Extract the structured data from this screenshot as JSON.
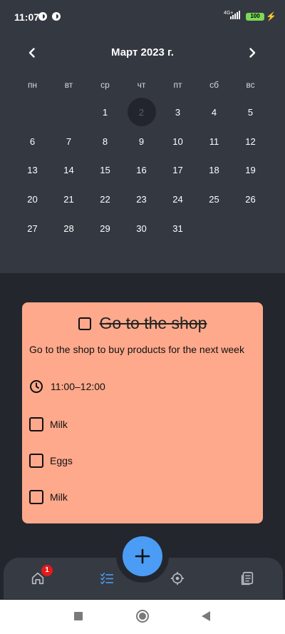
{
  "status_bar": {
    "time": "11:07",
    "network": "4G+",
    "battery": "100"
  },
  "calendar": {
    "month_title": "Март 2023 г.",
    "weekdays": [
      "пн",
      "вт",
      "ср",
      "чт",
      "пт",
      "сб",
      "вс"
    ],
    "leading_blanks": 2,
    "days": [
      "1",
      "2",
      "3",
      "4",
      "5",
      "6",
      "7",
      "8",
      "9",
      "10",
      "11",
      "12",
      "13",
      "14",
      "15",
      "16",
      "17",
      "18",
      "19",
      "20",
      "21",
      "22",
      "23",
      "24",
      "25",
      "26",
      "27",
      "28",
      "29",
      "30",
      "31"
    ],
    "selected_day": "2"
  },
  "task": {
    "title": "Go to the shop",
    "description": "Go to the shop to buy products for the next week",
    "time_range": "11:00–12:00",
    "subtasks": [
      {
        "label": "Milk",
        "checked": false
      },
      {
        "label": "Eggs",
        "checked": false
      },
      {
        "label": "Milk",
        "checked": false
      }
    ],
    "card_color": "#ffa98c"
  },
  "bottom_nav": {
    "home_badge": "1",
    "items": [
      "home-icon",
      "tasks-icon",
      "target-icon",
      "notes-icon"
    ],
    "active": "tasks-icon",
    "accent": "#4b9cf5"
  }
}
